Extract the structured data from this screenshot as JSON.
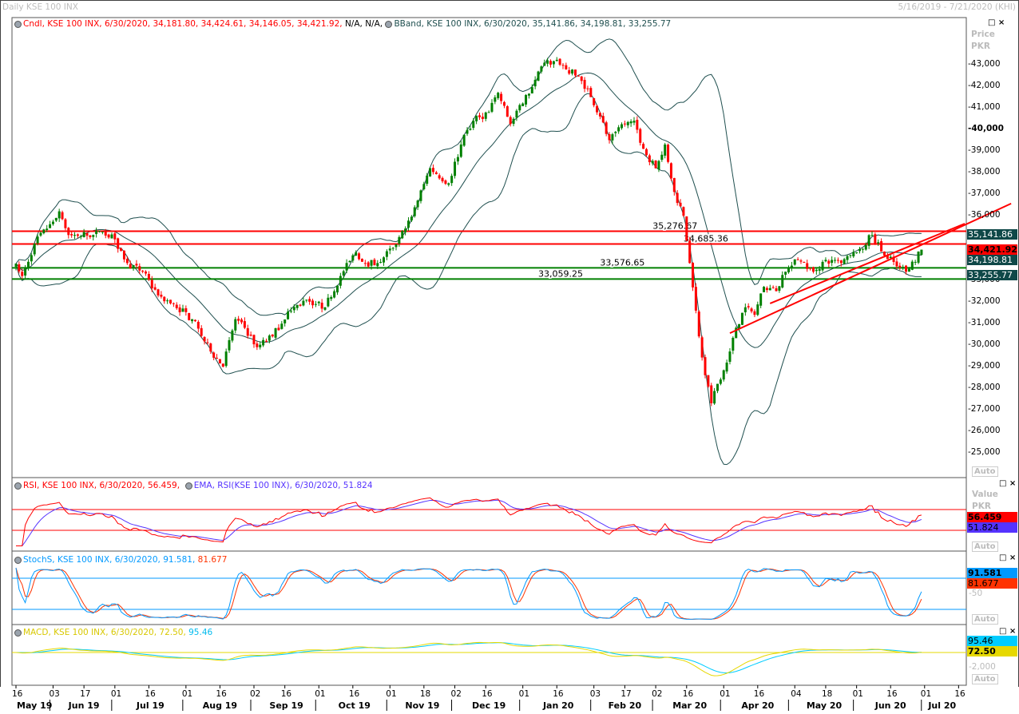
{
  "header": {
    "title": "Daily KSE 100 INX",
    "range": "5/16/2019 - 7/21/2020 (KHI)"
  },
  "legends": {
    "cndl": {
      "text": "Cndl, KSE 100 INX, 6/30/2020, 34,181.80, 34,424.61, 34,146.05, 34,421.92,",
      "na": "N/A, N/A,"
    },
    "bband": "BBand, KSE 100 INX, 6/30/2020, 35,141.86, 34,198.81, 33,255.77",
    "rsi": "RSI, KSE 100 INX, 6/30/2020, 56.459,",
    "ema": "EMA, RSI(KSE 100 INX), 6/30/2020, 51.824",
    "stoch": "StochS, KSE 100 INX, 6/30/2020, 91.581,",
    "stoch2": "81.677",
    "macd": "MACD, KSE 100 INX, 6/30/2020, 72.50,",
    "macd2": "95.46"
  },
  "axis": {
    "price_title": "Price",
    "price_unit": "PKR",
    "value_title": "Value",
    "value_unit": "PKR",
    "auto": "Auto",
    "stoch_mid": "-50",
    "macd_tick": "-2,000",
    "price_ticks": [
      "25,000",
      "26,000",
      "27,000",
      "28,000",
      "29,000",
      "30,000",
      "31,000",
      "32,000",
      "33,000",
      "36,000",
      "37,000",
      "38,000",
      "39,000",
      "40,000",
      "41,000",
      "42,000",
      "43,000"
    ]
  },
  "value_boxes": {
    "bb_upper": "35,141.86",
    "close": "34,421.92",
    "bb_mid": "34,198.81",
    "bb_lower": "33,255.77",
    "rsi": "56.459",
    "rsi_ema": "51.824",
    "stoch_k": "91.581",
    "stoch_d": "81.677",
    "macd_signal": "95.46",
    "macd": "72.50"
  },
  "colors": {
    "up": "#008000",
    "down": "#ff0000",
    "bband": "#1f4f4f",
    "rsi": "#ff0000",
    "ema": "#5533ff",
    "stoch_k": "#0099ff",
    "stoch_d": "#ff3300",
    "macd": "#e6d800",
    "signal": "#00ccff"
  },
  "chart_data": {
    "type": "candlestick",
    "instrument": "KSE 100 INX",
    "ylim": [
      24500,
      43500
    ],
    "last_candle": {
      "open": 34181.8,
      "high": 34424.61,
      "low": 34146.05,
      "close": 34421.92
    },
    "close_anchors": [
      [
        "2019-05-16",
        33780
      ],
      [
        "2019-05-20",
        33200
      ],
      [
        "2019-05-24",
        34700
      ],
      [
        "2019-05-31",
        35600
      ],
      [
        "2019-06-05",
        36200
      ],
      [
        "2019-06-10",
        35100
      ],
      [
        "2019-06-20",
        35100
      ],
      [
        "2019-06-25",
        35260
      ],
      [
        "2019-07-01",
        34900
      ],
      [
        "2019-07-05",
        33800
      ],
      [
        "2019-07-12",
        33400
      ],
      [
        "2019-07-19",
        32300
      ],
      [
        "2019-07-26",
        31900
      ],
      [
        "2019-08-05",
        31200
      ],
      [
        "2019-08-13",
        29700
      ],
      [
        "2019-08-19",
        29000
      ],
      [
        "2019-08-23",
        31200
      ],
      [
        "2019-08-28",
        30800
      ],
      [
        "2019-09-03",
        29900
      ],
      [
        "2019-09-10",
        30400
      ],
      [
        "2019-09-17",
        31550
      ],
      [
        "2019-09-25",
        32100
      ],
      [
        "2019-10-03",
        31750
      ],
      [
        "2019-10-10",
        33200
      ],
      [
        "2019-10-17",
        34300
      ],
      [
        "2019-10-22",
        33800
      ],
      [
        "2019-10-28",
        33800
      ],
      [
        "2019-11-04",
        34500
      ],
      [
        "2019-11-08",
        35400
      ],
      [
        "2019-11-14",
        36700
      ],
      [
        "2019-11-20",
        38200
      ],
      [
        "2019-11-28",
        37500
      ],
      [
        "2019-12-04",
        39300
      ],
      [
        "2019-12-10",
        40400
      ],
      [
        "2019-12-17",
        40800
      ],
      [
        "2019-12-20",
        41700
      ],
      [
        "2019-12-26",
        40250
      ],
      [
        "2020-01-01",
        41200
      ],
      [
        "2020-01-07",
        42300
      ],
      [
        "2020-01-13",
        43200
      ],
      [
        "2020-01-17",
        43000
      ],
      [
        "2020-01-24",
        42500
      ],
      [
        "2020-01-30",
        41900
      ],
      [
        "2020-02-05",
        40600
      ],
      [
        "2020-02-10",
        39500
      ],
      [
        "2020-02-15",
        40250
      ],
      [
        "2020-02-20",
        40400
      ],
      [
        "2020-02-25",
        39100
      ],
      [
        "2020-03-02",
        38200
      ],
      [
        "2020-03-05",
        39300
      ],
      [
        "2020-03-10",
        37100
      ],
      [
        "2020-03-13",
        36000
      ],
      [
        "2020-03-17",
        33800
      ],
      [
        "2020-03-20",
        30400
      ],
      [
        "2020-03-24",
        28600
      ],
      [
        "2020-03-26",
        27300
      ],
      [
        "2020-03-30",
        28200
      ],
      [
        "2020-04-03",
        29700
      ],
      [
        "2020-04-07",
        30800
      ],
      [
        "2020-04-10",
        31750
      ],
      [
        "2020-04-15",
        31400
      ],
      [
        "2020-04-20",
        32700
      ],
      [
        "2020-04-24",
        32500
      ],
      [
        "2020-04-29",
        33400
      ],
      [
        "2020-05-05",
        33950
      ],
      [
        "2020-05-12",
        33400
      ],
      [
        "2020-05-18",
        33950
      ],
      [
        "2020-05-25",
        33800
      ],
      [
        "2020-06-01",
        34300
      ],
      [
        "2020-06-08",
        35100
      ],
      [
        "2020-06-12",
        34150
      ],
      [
        "2020-06-19",
        33600
      ],
      [
        "2020-06-23",
        33400
      ],
      [
        "2020-06-30",
        34421.92
      ]
    ],
    "hlines": [
      {
        "value": 35276.67,
        "label": "35,276.67",
        "color": "#ff0000",
        "label_date": "2020-02-28"
      },
      {
        "value": 34685.36,
        "label": "34,685.36",
        "color": "#ff0000",
        "label_date": "2020-03-13"
      },
      {
        "value": 33576.65,
        "label": "33,576.65",
        "color": "#008000",
        "label_date": "2020-02-05"
      },
      {
        "value": 33059.25,
        "label": "33,059.25",
        "color": "#008000",
        "label_date": "2020-01-08"
      }
    ],
    "trendlines": [
      {
        "from": [
          "2020-04-03",
          30550
        ],
        "to": [
          "2020-08-10",
          36560
        ]
      },
      {
        "from": [
          "2020-04-22",
          31930
        ],
        "to": [
          "2020-07-20",
          35630
        ]
      }
    ],
    "indicators": {
      "bollinger": {
        "period": 20,
        "k": 2
      },
      "rsi": {
        "period": 14,
        "ema": 9,
        "levels": [
          70,
          30
        ]
      },
      "stoch": {
        "period": 14,
        "smooth": 3,
        "levels": [
          80,
          20
        ]
      },
      "macd": {
        "fast": 12,
        "slow": 26,
        "signal": 9
      }
    },
    "x_ticks": [
      [
        "2019-05-16",
        "16"
      ],
      [
        "2019-06-03",
        "03"
      ],
      [
        "2019-06-17",
        "17"
      ],
      [
        "2019-07-01",
        "01"
      ],
      [
        "2019-07-16",
        "16"
      ],
      [
        "2019-08-01",
        "01"
      ],
      [
        "2019-08-16",
        "16"
      ],
      [
        "2019-09-02",
        "02"
      ],
      [
        "2019-09-16",
        "16"
      ],
      [
        "2019-10-01",
        "01"
      ],
      [
        "2019-10-16",
        "16"
      ],
      [
        "2019-11-01",
        "01"
      ],
      [
        "2019-11-18",
        "18"
      ],
      [
        "2019-12-02",
        "02"
      ],
      [
        "2019-12-16",
        "16"
      ],
      [
        "2020-01-01",
        "01"
      ],
      [
        "2020-01-16",
        "16"
      ],
      [
        "2020-02-03",
        "03"
      ],
      [
        "2020-02-17",
        "17"
      ],
      [
        "2020-03-02",
        "02"
      ],
      [
        "2020-03-16",
        "16"
      ],
      [
        "2020-04-01",
        "01"
      ],
      [
        "2020-04-16",
        "16"
      ],
      [
        "2020-05-04",
        "04"
      ],
      [
        "2020-05-18",
        "18"
      ],
      [
        "2020-06-01",
        "01"
      ],
      [
        "2020-06-16",
        "16"
      ],
      [
        "2020-07-01",
        "01"
      ],
      [
        "2020-07-16",
        "16"
      ]
    ],
    "months": [
      [
        "2019-05-16",
        "May 19"
      ],
      [
        "2019-06-01",
        "Jun 19"
      ],
      [
        "2019-07-01",
        "Jul 19"
      ],
      [
        "2019-08-01",
        "Aug 19"
      ],
      [
        "2019-09-01",
        "Sep 19"
      ],
      [
        "2019-10-01",
        "Oct 19"
      ],
      [
        "2019-11-01",
        "Nov 19"
      ],
      [
        "2019-12-01",
        "Dec 19"
      ],
      [
        "2020-01-01",
        "Jan 20"
      ],
      [
        "2020-02-01",
        "Feb 20"
      ],
      [
        "2020-03-01",
        "Mar 20"
      ],
      [
        "2020-04-01",
        "Apr 20"
      ],
      [
        "2020-05-01",
        "May 20"
      ],
      [
        "2020-06-01",
        "Jun 20"
      ],
      [
        "2020-07-01",
        "Jul 20"
      ]
    ]
  }
}
